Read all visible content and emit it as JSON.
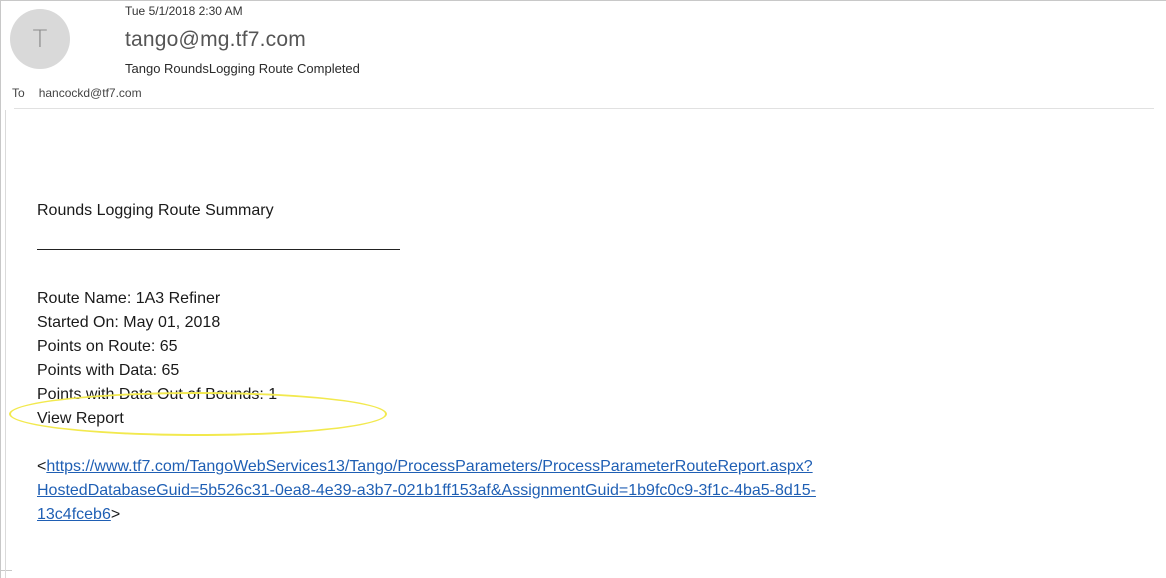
{
  "header": {
    "avatar_initial": "T",
    "date": "Tue 5/1/2018 2:30 AM",
    "sender": "tango@mg.tf7.com",
    "subject": "Tango RoundsLogging Route Completed",
    "to_label": "To",
    "to_address": "hancockd@tf7.com"
  },
  "body": {
    "summary_title": "Rounds Logging Route Summary",
    "lines": [
      "Route Name: 1A3 Refiner",
      "Started On: May 01, 2018",
      "Points on Route: 65",
      "Points with Data: 65",
      "Points with Data Out of Bounds: 1",
      "View Report"
    ],
    "link_open": "<",
    "link_text_1": "https://www.tf7.com/TangoWebServices13/Tango/ProcessParameters/ProcessParameterRouteReport.aspx?",
    "link_text_2": "HostedDatabaseGuid=5b526c31-0ea8-4e39-a3b7-021b1ff153af&AssignmentGuid=1b9fc0c9-3f1c-4ba5-8d15-",
    "link_text_3": "13c4fceb6",
    "link_close": ">"
  },
  "colors": {
    "link": "#1f5fb4",
    "highlight": "#f2e94e",
    "avatar_bg": "#d9d9d9"
  }
}
